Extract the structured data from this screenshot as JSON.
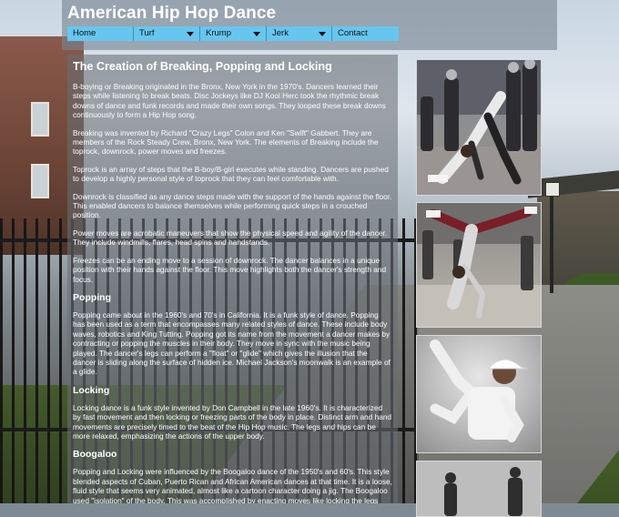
{
  "site_title": "American Hip Hop Dance",
  "nav": [
    {
      "label": "Home",
      "dropdown": false
    },
    {
      "label": "Turf",
      "dropdown": true
    },
    {
      "label": "Krump",
      "dropdown": true
    },
    {
      "label": "Jerk",
      "dropdown": true
    },
    {
      "label": "Contact",
      "dropdown": false
    }
  ],
  "content": {
    "heading": "The Creation of Breaking, Popping and Locking",
    "intro_paragraphs": [
      "B-boying or Breaking originated in the Bronx, New York in the 1970's. Dancers learned their steps while listening to break beats. Disc Jockeys like DJ Kool Herc took the rhythmic break downs of dance and funk records and made their own songs. They looped these break downs continuously to form a Hip Hop song.",
      "Breaking was invented by Richard \"Crazy Legs\" Colon and Ken \"Swift\" Gabbert. They are members of the Rock Steady Crew, Bronx, New York. The elements of Breaking include the toprock, downrock, power moves and freezes.",
      "Toprock is an array of steps that the B-boy/B-girl executes while standing. Dancers are pushed to develop a highly personal style of toprock that they can feel comfortable with.",
      "Downrock is classified as any dance steps made with the support of the hands against the floor. This enabled dancers to balance themselves while performing quick steps in a crouched position.",
      "Power moves are acrobatic maneuvers that show the physical speed and agility of the dancer. They include windmills, flares, head spins and handstands.",
      "Freezes can be an ending move to a session of downrock. The dancer balances in a unique position with their hands against the floor. This move highlights both the dancer's strength and focus."
    ],
    "popping_heading": "Popping",
    "popping_text": "Popping came about in the 1960's and 70's in California. It is a funk style of dance. Popping has been used as a term that encompasses many related styles of dance. These include body waves, robotics and King Tutting. Popping got its name from the movement a dancer makes by contracting or popping the muscles in their body. They move in sync with the music being played. The dancer's legs can perform a \"float\" or \"glide\" which gives the illusion that the dancer is sliding along the surface of hidden ice. Michael Jackson's moonwalk is an example of a glide.",
    "locking_heading": "Locking",
    "locking_text": "Locking dance is a funk style invented by Don Campbell in the late 1960's. It is characterized by fast movement and then locking or freezing parts of the body in place. Distinct arm and hand movements are precisely timed to the beat of the Hip Hop music. The legs and hips can be more relaxed, emphasizing the actions of the upper body.",
    "boogaloo_heading": "Boogaloo",
    "boogaloo_text": "Popping and Locking were influenced by the Boogaloo dance of the 1950's and 60's. This style blended aspects of Cuban, Puerto Rican and African American dances at that time. It is a loose, fluid style that seems very animated, almost like a cartoon character doing a jig. The Boogaloo used \"isolation\" of the body. This was accomplished by enacting moves like locking the legs and hips in place while the upper body continues to move. The dancer's limbs were shifted into different positions and angles. This"
  },
  "colors": {
    "nav_bar": "#66c6ef",
    "header_overlay": "rgba(120,132,146,0.62)",
    "content_overlay": "rgba(105,110,115,0.58)",
    "text": "#ffffff"
  }
}
